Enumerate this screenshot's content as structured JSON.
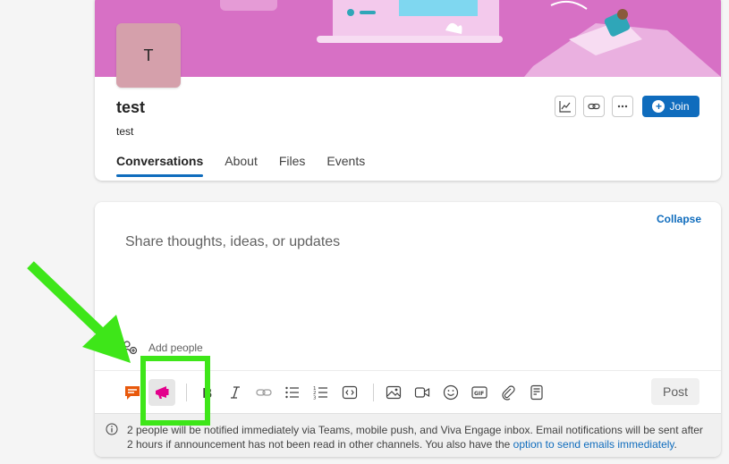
{
  "group": {
    "avatar_letter": "T",
    "name": "test",
    "description": "test",
    "join_label": "Join",
    "banner_color": "#d770c5"
  },
  "tabs": [
    {
      "label": "Conversations",
      "active": true
    },
    {
      "label": "About",
      "active": false
    },
    {
      "label": "Files",
      "active": false
    },
    {
      "label": "Events",
      "active": false
    }
  ],
  "composer": {
    "collapse_label": "Collapse",
    "placeholder": "Share thoughts, ideas, or updates",
    "add_people_label": "Add people",
    "post_label": "Post",
    "toolbar_icons": [
      "discussion-icon",
      "announcement-icon",
      "bold-icon",
      "italic-icon",
      "link-icon",
      "bullet-list-icon",
      "numbered-list-icon",
      "code-icon",
      "image-icon",
      "video-icon",
      "emoji-icon",
      "gif-icon",
      "attachment-icon",
      "template-icon"
    ]
  },
  "notice": {
    "text": "2 people will be notified immediately via Teams, mobile push, and Viva Engage inbox. Email notifications will be sent after 2 hours if announcement has not been read in other channels. You also have the ",
    "link": "option to send emails immediately",
    "end": "."
  },
  "colors": {
    "accent": "#0f6cbd",
    "annotation": "#3ee619",
    "announcement": "#e3008c",
    "discussion": "#e8590c"
  }
}
